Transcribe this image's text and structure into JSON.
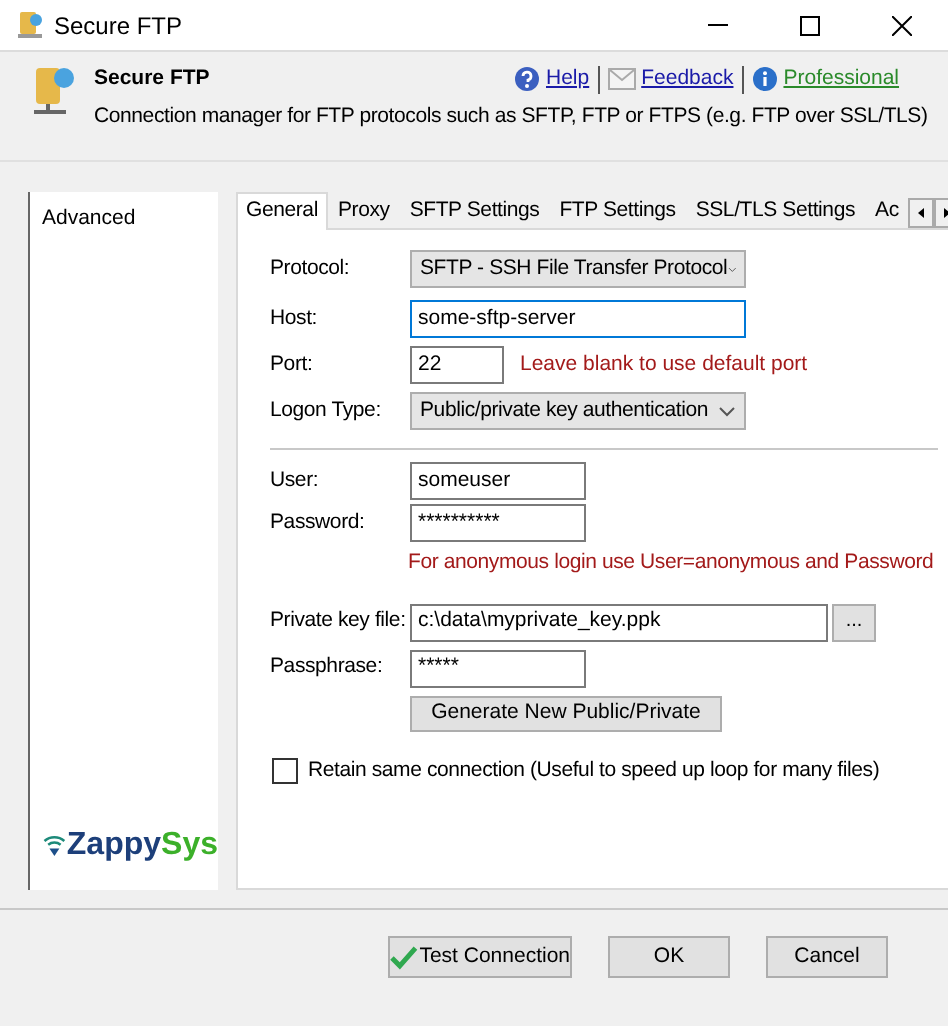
{
  "window": {
    "title": "Secure FTP"
  },
  "header": {
    "title": "Secure FTP",
    "description": "Connection manager for FTP protocols such as SFTP, FTP or FTPS (e.g. FTP over SSL/TLS)",
    "links": [
      {
        "label": "Help",
        "kind": "help"
      },
      {
        "label": "Feedback",
        "kind": "feedback"
      },
      {
        "label": "Professional",
        "kind": "edition"
      }
    ]
  },
  "sidebar": {
    "items": [
      {
        "label": "Advanced",
        "selected": false
      }
    ]
  },
  "logo": {
    "part1": "Zappy",
    "part2": "Sys"
  },
  "tabs": [
    {
      "label": "General",
      "selected": true
    },
    {
      "label": "Proxy",
      "selected": false
    },
    {
      "label": "SFTP Settings",
      "selected": false
    },
    {
      "label": "FTP Settings",
      "selected": false
    },
    {
      "label": "SSL/TLS Settings",
      "selected": false
    },
    {
      "label": "Ac",
      "selected": false
    }
  ],
  "form": {
    "protocol": {
      "label": "Protocol:",
      "value": "SFTP - SSH File Transfer Protocol"
    },
    "host": {
      "label": "Host:",
      "value": "some-sftp-server"
    },
    "port": {
      "label": "Port:",
      "value": "22",
      "hint": "Leave blank to use default port"
    },
    "logon_type": {
      "label": "Logon Type:",
      "value": "Public/private key authentication"
    },
    "user": {
      "label": "User:",
      "value": "someuser"
    },
    "password": {
      "label": "Password:",
      "value": "**********",
      "hint": "For anonymous login use User=anonymous and Password"
    },
    "private_key_file": {
      "label": "Private key file:",
      "value": "c:\\data\\myprivate_key.ppk",
      "browse": "..."
    },
    "passphrase": {
      "label": "Passphrase:",
      "value": "*****"
    },
    "generate_button": "Generate New Public/Private",
    "retain_connection": {
      "label": "Retain same connection (Useful to speed up loop for many files)",
      "checked": false
    }
  },
  "buttons": [
    {
      "label": "Test Connection",
      "kind": "test"
    },
    {
      "label": "OK",
      "kind": "ok"
    },
    {
      "label": "Cancel",
      "kind": "cancel"
    }
  ]
}
